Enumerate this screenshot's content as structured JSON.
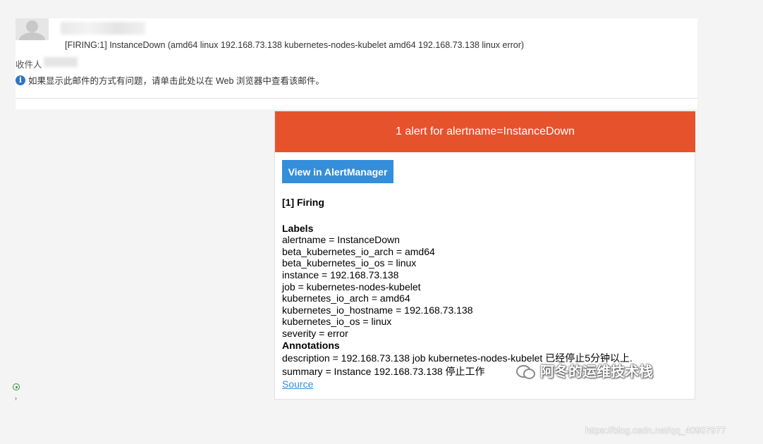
{
  "email": {
    "subject": "[FIRING:1] InstanceDown (amd64 linux 192.168.73.138 kubernetes-nodes-kubelet amd64 192.168.73.138 linux error)",
    "recipient_label": "收件人",
    "info_message": "如果显示此邮件的方式有问题，请单击此处以在 Web 浏览器中查看该邮件。"
  },
  "alert": {
    "banner": "1 alert for alertname=InstanceDown",
    "button_label": "View in AlertManager",
    "status_heading": "[1] Firing",
    "labels_heading": "Labels",
    "labels": [
      "alertname = InstanceDown",
      "beta_kubernetes_io_arch = amd64",
      "beta_kubernetes_io_os = linux",
      "instance = 192.168.73.138",
      "job = kubernetes-nodes-kubelet",
      "kubernetes_io_arch = amd64",
      "kubernetes_io_hostname = 192.168.73.138",
      "kubernetes_io_os = linux",
      "severity = error"
    ],
    "annotations_heading": "Annotations",
    "annotations": [
      "description = 192.168.73.138 job kubernetes-nodes-kubelet 已经停止5分钟以上.",
      "summary = Instance 192.168.73.138 停止工作"
    ],
    "source_label": "Source"
  },
  "watermark": {
    "text": "阿冬的运维技术栈",
    "url": "https://blog.csdn.net/qq_40907977"
  },
  "colors": {
    "banner": "#e6522c",
    "button": "#348eda",
    "info_icon": "#2e74c9"
  }
}
